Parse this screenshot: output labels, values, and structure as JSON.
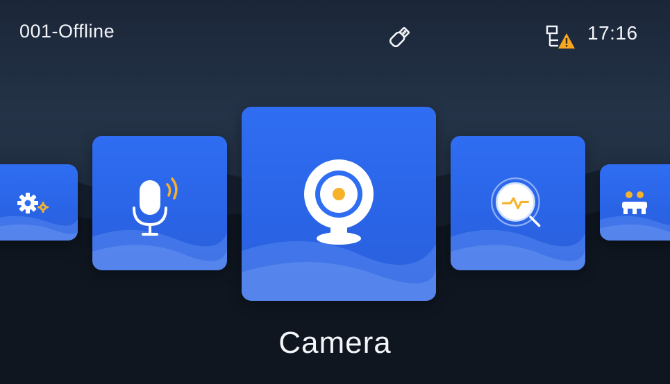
{
  "status": {
    "device_status": "001-Offline",
    "time": "17:16",
    "usb_icon": "usb-drive-icon",
    "network_icon": "network-warning-icon"
  },
  "carousel": {
    "items": [
      {
        "id": "settings",
        "icon": "settings-gears-icon"
      },
      {
        "id": "voice",
        "icon": "microphone-icon"
      },
      {
        "id": "camera",
        "icon": "webcam-icon",
        "selected": true
      },
      {
        "id": "diagnostics",
        "icon": "heartbeat-search-icon"
      },
      {
        "id": "users",
        "icon": "group-people-icon"
      }
    ],
    "selected_label": "Camera"
  },
  "colors": {
    "tile": "#2f6df2",
    "accent": "#f5b22a",
    "text": "#f2f4f7"
  }
}
